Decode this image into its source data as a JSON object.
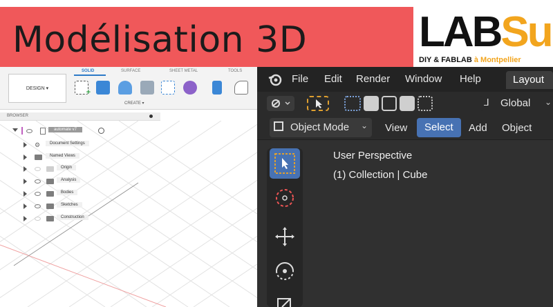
{
  "banner": {
    "title": "Modélisation 3D",
    "logo_lab": "LAB",
    "logo_sud": "Sud",
    "tagline_main": "DIY & FABLAB ",
    "tagline_a": "à",
    "tagline_city": " Montpellier"
  },
  "colors": {
    "banner_red": "#f0585a",
    "logo_orange": "#f2a51e",
    "blender_select": "#4772b3",
    "fusion_accent": "#2c79c7"
  },
  "fusion": {
    "design_button": "DESIGN ▾",
    "tabs": [
      "SOLID",
      "SURFACE",
      "SHEET METAL",
      "TOOLS"
    ],
    "create_label": "CREATE ▾",
    "browser_label": "BROWSER",
    "root_item": "automate v7",
    "tree_items": [
      "Document Settings",
      "Named Views",
      "Origin",
      "Analysis",
      "Bodies",
      "Sketches",
      "Construction"
    ]
  },
  "blender": {
    "menu": [
      "File",
      "Edit",
      "Render",
      "Window",
      "Help"
    ],
    "layout_tab": "Layout",
    "orientation": "Global",
    "mode": "Object Mode",
    "mode_menu": [
      "View",
      "Select",
      "Add",
      "Object"
    ],
    "viewport_line1": "User Perspective",
    "viewport_line2": "(1) Collection | Cube",
    "icons": [
      "blender-logo-icon",
      "select-box-icon",
      "cursor-icon",
      "move-icon",
      "rotate-icon",
      "scale-icon"
    ]
  }
}
